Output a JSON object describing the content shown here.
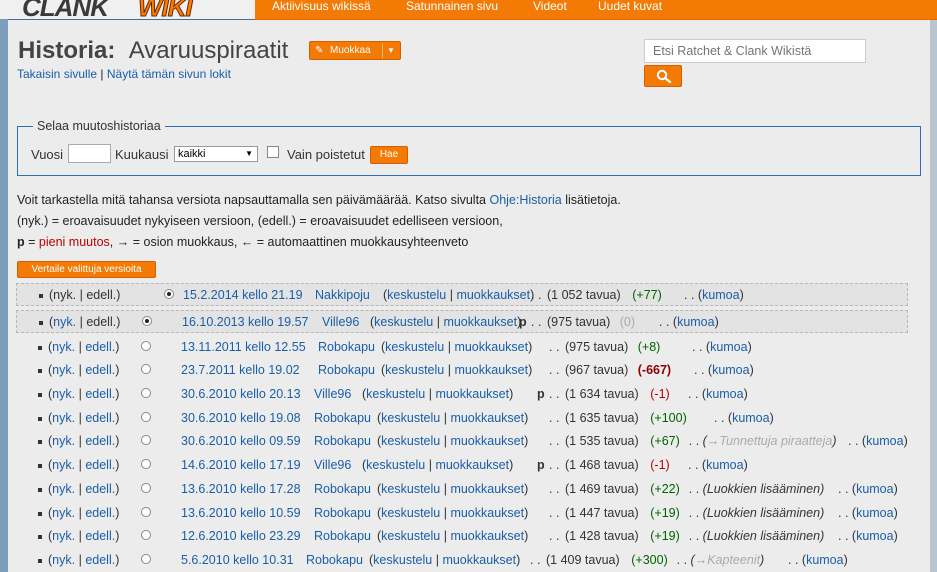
{
  "logo": {
    "part1": "CLANK",
    "part2": "WIKI"
  },
  "nav": {
    "items": [
      "Aktiivisuus wikissä",
      "Satunnainen sivu",
      "Videot",
      "Uudet kuvat"
    ]
  },
  "page": {
    "title_prefix": "Historia:",
    "title": "Avaruuspiraatit",
    "edit_button": "Muokkaa",
    "back_link": "Takaisin sivulle",
    "separator": "|",
    "log_link": "Näytä tämän sivun lokit"
  },
  "search": {
    "placeholder": "Etsi Ratchet & Clank Wikistä"
  },
  "browse": {
    "legend": "Selaa muutoshistoriaa",
    "year_label": "Vuosi",
    "month_label": "Kuukausi",
    "month_value": "kaikki",
    "deleted_label": "Vain poistetut",
    "go_button": "Hae"
  },
  "info": {
    "line1_text": "Voit tarkastella mitä tahansa versiota napsauttamalla sen päivämäärää. Katso sivulta",
    "line1_link": "Ohje:Historia",
    "line1_end": "lisätietoja.",
    "line2": "(nyk.) = eroavaisuudet nykyiseen versioon, (edell.) = eroavaisuudet edelliseen versioon,",
    "line3_p": "p",
    "line3_eq": "=",
    "line3_minor": "pieni muutos",
    "line3_rest": ", → = osion muokkaus, ← = automaattinen muokkausyhteenveto"
  },
  "compare_button": "Vertaile valittuja versioita",
  "history": [
    {
      "cur": "nyk.",
      "prev": "edell.",
      "date": "15.2.2014 kello 21.19",
      "user": "Nakkipoju",
      "talk": "keskustelu",
      "contribs": "muokkaukset",
      "minor": "",
      "size": "(1 052 tavua)",
      "diff": "(+77)",
      "comment_arrow": "",
      "comment": "",
      "undo": "kumoa"
    },
    {
      "cur": "nyk.",
      "prev": "edell.",
      "date": "16.10.2013 kello 19.57",
      "user": "Ville96",
      "talk": "keskustelu",
      "contribs": "muokkaukset",
      "minor": "p",
      "size": "(975 tavua)",
      "diff": "(0)",
      "comment_arrow": "",
      "comment": "",
      "undo": "kumoa"
    },
    {
      "cur": "nyk.",
      "prev": "edell.",
      "date": "13.11.2011 kello 12.55",
      "user": "Robokapu",
      "talk": "keskustelu",
      "contribs": "muokkaukset",
      "minor": "",
      "size": "(975 tavua)",
      "diff": "(+8)",
      "comment_arrow": "",
      "comment": "",
      "undo": "kumoa"
    },
    {
      "cur": "nyk.",
      "prev": "edell.",
      "date": "23.7.2011 kello 19.02",
      "user": "Robokapu",
      "talk": "keskustelu",
      "contribs": "muokkaukset",
      "minor": "",
      "size": "(967 tavua)",
      "diff": "(-667)",
      "comment_arrow": "",
      "comment": "",
      "undo": "kumoa"
    },
    {
      "cur": "nyk.",
      "prev": "edell.",
      "date": "30.6.2010 kello 20.13",
      "user": "Ville96",
      "talk": "keskustelu",
      "contribs": "muokkaukset",
      "minor": "p",
      "size": "(1 634 tavua)",
      "diff": "(-1)",
      "comment_arrow": "",
      "comment": "",
      "undo": "kumoa"
    },
    {
      "cur": "nyk.",
      "prev": "edell.",
      "date": "30.6.2010 kello 19.08",
      "user": "Robokapu",
      "talk": "keskustelu",
      "contribs": "muokkaukset",
      "minor": "",
      "size": "(1 635 tavua)",
      "diff": "(+100)",
      "comment_arrow": "",
      "comment": "",
      "undo": "kumoa"
    },
    {
      "cur": "nyk.",
      "prev": "edell.",
      "date": "30.6.2010 kello 09.59",
      "user": "Robokapu",
      "talk": "keskustelu",
      "contribs": "muokkaukset",
      "minor": "",
      "size": "(1 535 tavua)",
      "diff": "(+67)",
      "comment_arrow": "→",
      "comment": "Tunnettuja piraatteja",
      "undo": "kumoa"
    },
    {
      "cur": "nyk.",
      "prev": "edell.",
      "date": "14.6.2010 kello 17.19",
      "user": "Ville96",
      "talk": "keskustelu",
      "contribs": "muokkaukset",
      "minor": "p",
      "size": "(1 468 tavua)",
      "diff": "(-1)",
      "comment_arrow": "",
      "comment": "",
      "undo": "kumoa"
    },
    {
      "cur": "nyk.",
      "prev": "edell.",
      "date": "13.6.2010 kello 17.28",
      "user": "Robokapu",
      "talk": "keskustelu",
      "contribs": "muokkaukset",
      "minor": "",
      "size": "(1 469 tavua)",
      "diff": "(+22)",
      "comment_arrow": "",
      "comment": "Luokkien lisääminen",
      "undo": "kumoa"
    },
    {
      "cur": "nyk.",
      "prev": "edell.",
      "date": "13.6.2010 kello 10.59",
      "user": "Robokapu",
      "talk": "keskustelu",
      "contribs": "muokkaukset",
      "minor": "",
      "size": "(1 447 tavua)",
      "diff": "(+19)",
      "comment_arrow": "",
      "comment": "Luokkien lisääminen",
      "undo": "kumoa"
    },
    {
      "cur": "nyk.",
      "prev": "edell.",
      "date": "12.6.2010 kello 23.29",
      "user": "Robokapu",
      "talk": "keskustelu",
      "contribs": "muokkaukset",
      "minor": "",
      "size": "(1 428 tavua)",
      "diff": "(+19)",
      "comment_arrow": "",
      "comment": "Luokkien lisääminen",
      "undo": "kumoa"
    },
    {
      "cur": "nyk.",
      "prev": "edell.",
      "date": "5.6.2010 kello 10.31",
      "user": "Robokapu",
      "talk": "keskustelu",
      "contribs": "muokkaukset",
      "minor": "",
      "size": "(1 409 tavua)",
      "diff": "(+300)",
      "comment_arrow": "→",
      "comment": "Kapteenit",
      "undo": "kumoa"
    }
  ],
  "colors": {
    "accent": "#f27a05",
    "link": "#1a5ea8",
    "positive": "#006400",
    "negative": "#ba0000"
  }
}
